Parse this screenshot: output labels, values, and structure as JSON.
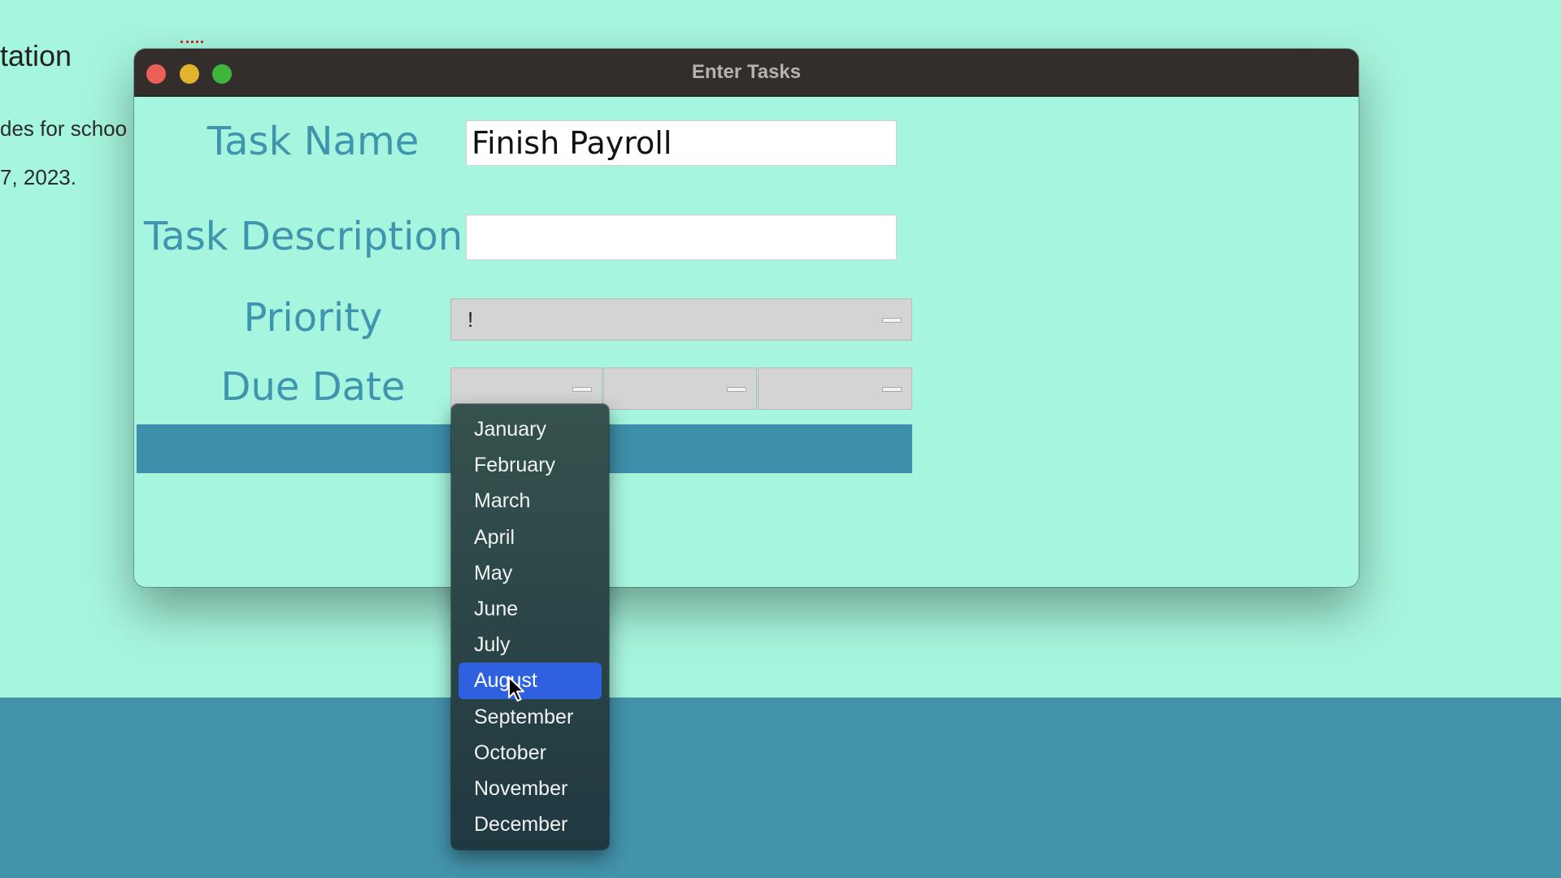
{
  "background": {
    "heading_fragment": "tation",
    "line1_fragment": "des for schoo",
    "line2_fragment": "7, 2023."
  },
  "window": {
    "title": "Enter Tasks"
  },
  "form": {
    "task_name_label": "Task Name",
    "task_name_value": "Finish Payroll",
    "task_description_label": "Task Description",
    "task_description_value": "",
    "priority_label": "Priority",
    "priority_value": "!",
    "due_date_label": "Due Date",
    "due_month_value": "",
    "due_day_value": "",
    "due_year_value": ""
  },
  "month_dropdown": {
    "options": [
      "January",
      "February",
      "March",
      "April",
      "May",
      "June",
      "July",
      "August",
      "September",
      "October",
      "November",
      "December"
    ],
    "highlighted": "August"
  },
  "colors": {
    "background": "#a6f5de",
    "label_text": "#3e95ad",
    "submit_bar": "#3e8fab",
    "band": "#4393ab",
    "menu_highlight": "#2e60e0"
  },
  "icons": {
    "close": "close-traffic-light-icon",
    "minimize": "minimize-traffic-light-icon",
    "maximize": "maximize-traffic-light-icon",
    "dropdown_arrow": "dash-arrow-icon",
    "cursor": "mouse-pointer-icon"
  }
}
